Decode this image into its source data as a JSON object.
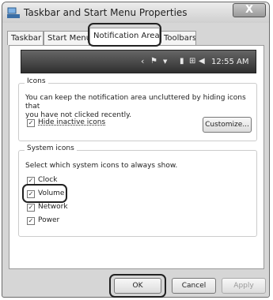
{
  "window": {
    "title": "Taskbar and Start Menu Properties",
    "close_label": "X"
  },
  "tabs": [
    {
      "label": "Taskbar"
    },
    {
      "label": "Start Menu"
    },
    {
      "label": "Notification Area",
      "active": true
    },
    {
      "label": "Toolbars"
    }
  ],
  "taskbar_preview": {
    "clock": "12:55 AM",
    "chevron": "‹",
    "flag_icon": "flag-icon",
    "battery_icon": "battery-icon",
    "network_icon": "network-icon",
    "volume_icon": "volume-icon"
  },
  "icons_group": {
    "title": "Icons",
    "description_line1": "You can keep the notification area uncluttered by hiding icons that",
    "description_line2": "you have not clicked recently.",
    "hide_inactive_label": "Hide inactive icons",
    "hide_inactive_checked": true,
    "customize_label": "Customize..."
  },
  "system_icons_group": {
    "title": "System icons",
    "description": "Select which system icons to always show.",
    "items": [
      {
        "label": "Clock",
        "checked": true
      },
      {
        "label": "Volume",
        "checked": true
      },
      {
        "label": "Network",
        "checked": true
      },
      {
        "label": "Power",
        "checked": true
      }
    ]
  },
  "footer": {
    "ok_label": "OK",
    "cancel_label": "Cancel",
    "apply_label": "Apply"
  }
}
